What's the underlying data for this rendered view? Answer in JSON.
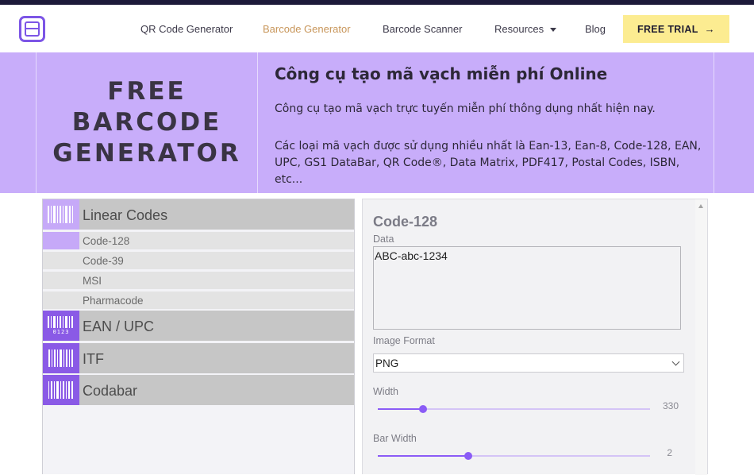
{
  "nav": {
    "items": [
      {
        "label": "QR Code Generator"
      },
      {
        "label": "Barcode Generator",
        "active": true
      },
      {
        "label": "Barcode Scanner"
      },
      {
        "label": "Resources"
      },
      {
        "label": "Blog"
      }
    ],
    "cta_label": "FREE TRIAL",
    "cta_arrow": "→"
  },
  "hero": {
    "left_title_lines": [
      "FREE",
      "BARCODE",
      "GENERATOR"
    ],
    "title": "Công cụ tạo mã vạch miễn phí Online",
    "description": "Công cụ tạo mã vạch trực tuyến miễn phí thông dụng nhất hiện nay.",
    "types_text": "Các loại mã vạch được sử dụng nhiều nhất là Ean-13, Ean-8, Code-128, EAN, UPC, GS1 DataBar, QR Code®, Data Matrix, PDF417, Postal Codes, ISBN, etc..."
  },
  "sidebar": {
    "categories": [
      {
        "label": "Linear Codes",
        "subitems": [
          "Code-128",
          "Code-39",
          "MSI",
          "Pharmacode"
        ],
        "active_sub": "Code-128"
      },
      {
        "label": "EAN / UPC",
        "icon_digits": "0123"
      },
      {
        "label": "ITF"
      },
      {
        "label": "Codabar"
      }
    ]
  },
  "panel": {
    "title": "Code-128",
    "data_label": "Data",
    "data_value": "ABC-abc-1234",
    "format_label": "Image Format",
    "format_value": "PNG",
    "width_label": "Width",
    "width_value": "330",
    "width_fraction": 0.165,
    "barwidth_label": "Bar Width",
    "barwidth_value": "2",
    "barwidth_fraction": 0.333
  },
  "colors": {
    "accent": "#8b5cf6",
    "hero_bg": "#c8adfa",
    "cta_bg": "#fcec91",
    "active_nav": "#c8965a",
    "topbar": "#1d1a3a"
  }
}
